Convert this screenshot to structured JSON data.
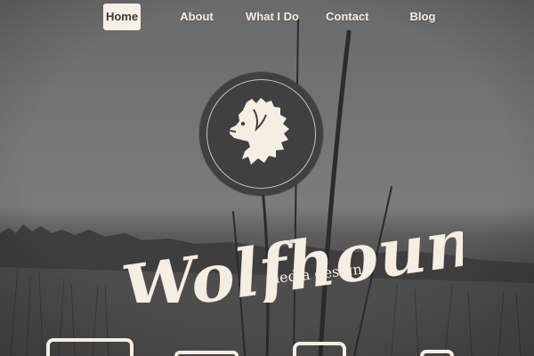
{
  "nav": {
    "items": [
      {
        "label": "Home",
        "active": true
      },
      {
        "label": "About",
        "active": false
      },
      {
        "label": "What I Do",
        "active": false
      },
      {
        "label": "Contact",
        "active": false
      },
      {
        "label": "Blog",
        "active": false
      }
    ]
  },
  "brand": {
    "title": "Wolfhound",
    "subtitle": "media design",
    "logo_icon": "wolfhound-head-icon"
  },
  "colors": {
    "cream": "#f6ede3",
    "disc": "#404040",
    "background": "#6e6e6e"
  }
}
